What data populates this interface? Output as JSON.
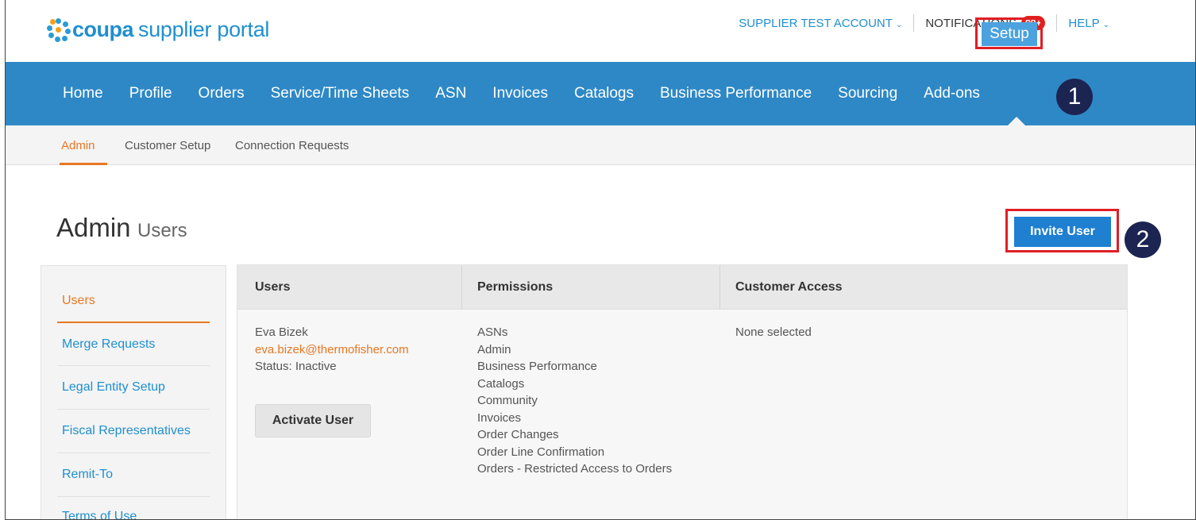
{
  "header": {
    "brand": "coupa",
    "portal": "supplier portal",
    "account_label": "SUPPLIER TEST ACCOUNT",
    "notifications_label": "NOTIFICATIONS",
    "notifications_badge": "99+",
    "help_label": "HELP"
  },
  "nav": {
    "items": [
      "Home",
      "Profile",
      "Orders",
      "Service/Time Sheets",
      "ASN",
      "Invoices",
      "Catalogs",
      "Business Performance",
      "Sourcing",
      "Add-ons"
    ],
    "active": "Setup"
  },
  "subnav": {
    "items": [
      "Admin",
      "Customer Setup",
      "Connection Requests"
    ]
  },
  "callouts": [
    "1",
    "2"
  ],
  "page": {
    "title": "Admin",
    "subtitle": "Users",
    "invite_button": "Invite User"
  },
  "sidebar": {
    "items": [
      "Users",
      "Merge Requests",
      "Legal Entity Setup",
      "Fiscal Representatives",
      "Remit-To",
      "Terms of Use"
    ]
  },
  "table": {
    "headers": [
      "Users",
      "Permissions",
      "Customer Access"
    ],
    "row": {
      "name": "Eva Bizek",
      "email": "eva.bizek@thermofisher.com",
      "status": "Status: Inactive",
      "activate_button": "Activate User",
      "permissions": [
        "ASNs",
        "Admin",
        "Business Performance",
        "Catalogs",
        "Community",
        "Invoices",
        "Order Changes",
        "Order Line Confirmation",
        "Orders - Restricted Access to Orders"
      ],
      "customer_access": "None selected"
    }
  },
  "colors": {
    "nav_blue": "#2e88c6",
    "accent_orange": "#e87722",
    "highlight_red": "#e01e25",
    "callout_navy": "#1c2452"
  }
}
